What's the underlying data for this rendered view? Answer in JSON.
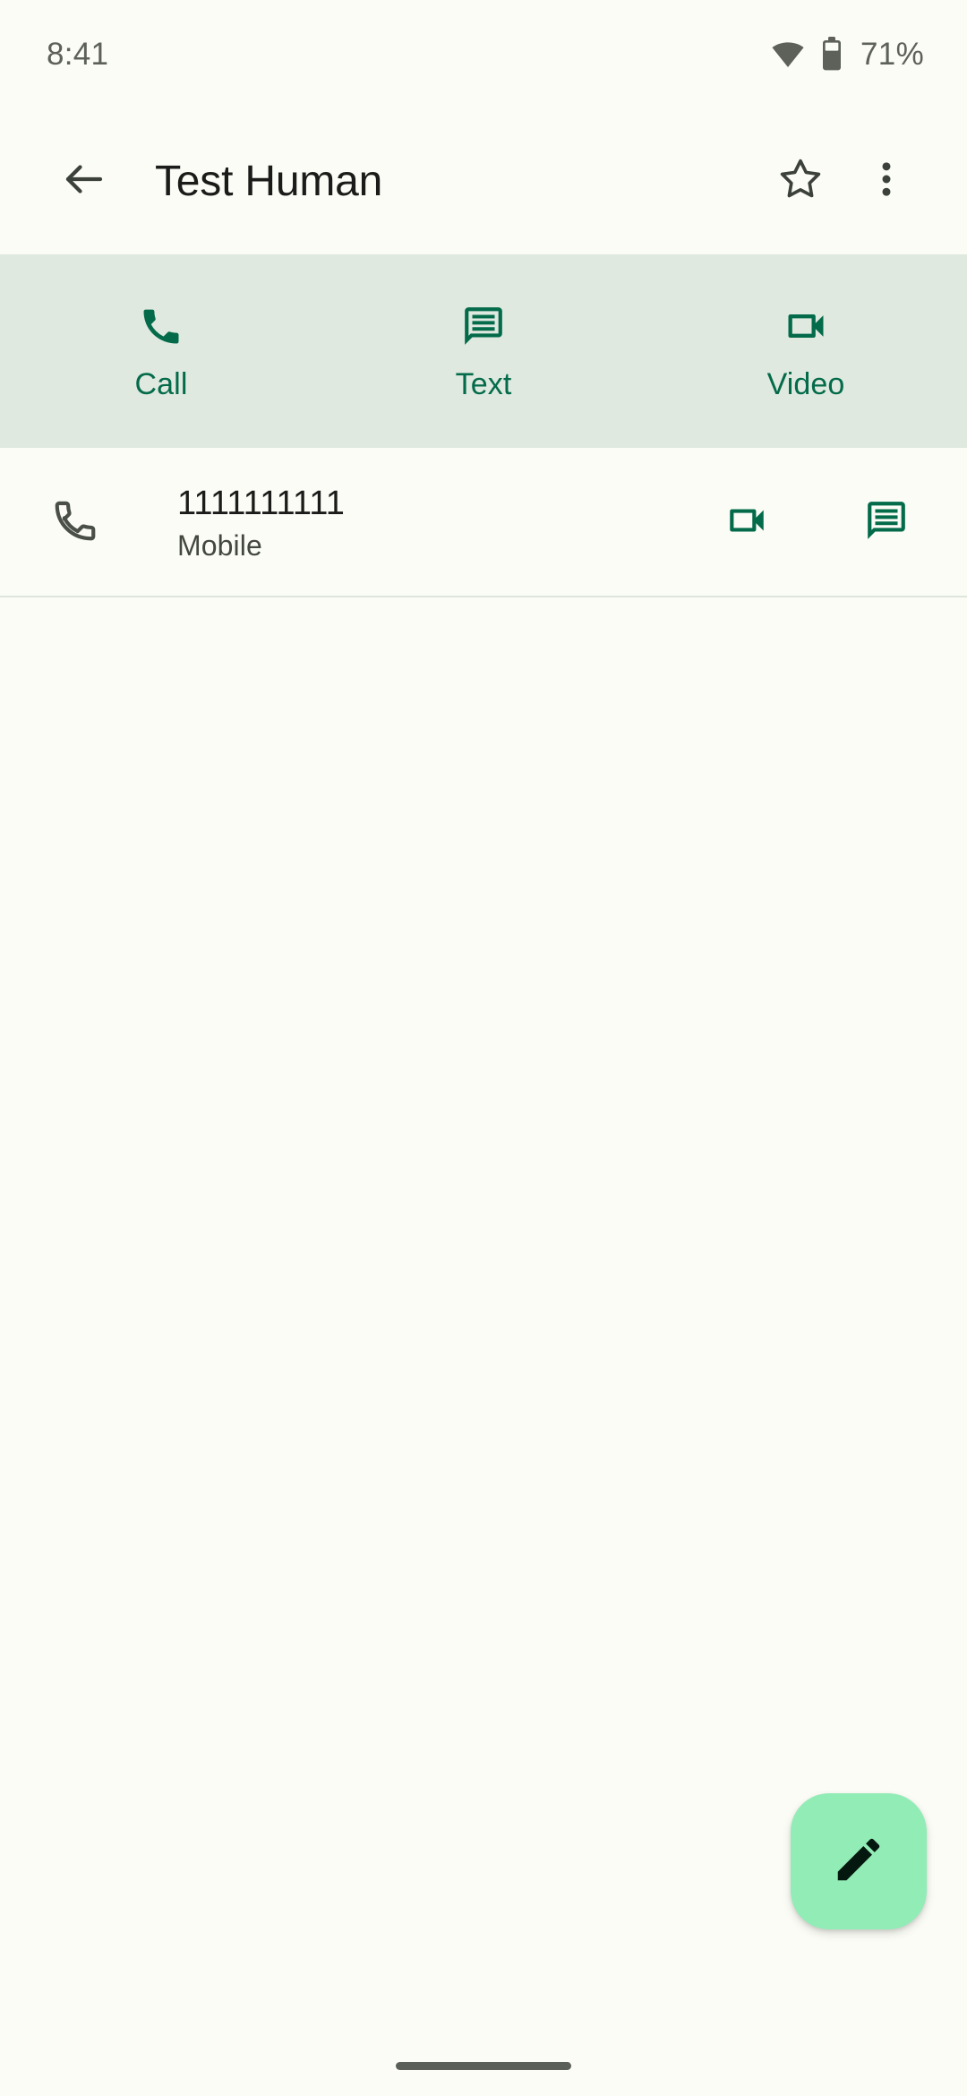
{
  "status_bar": {
    "time": "8:41",
    "battery_percent": "71%",
    "wifi_icon": "wifi-icon",
    "battery_icon": "battery-icon"
  },
  "app_bar": {
    "back_icon": "back-arrow-icon",
    "title": "Test Human",
    "favorite_icon": "star-outline-icon",
    "overflow_icon": "more-vert-icon"
  },
  "quick_actions": [
    {
      "label": "Call",
      "icon": "phone-icon"
    },
    {
      "label": "Text",
      "icon": "message-icon"
    },
    {
      "label": "Video",
      "icon": "videocam-icon"
    }
  ],
  "phone_entry": {
    "lead_icon": "phone-icon",
    "number": "1111111111",
    "type": "Mobile",
    "actions": [
      {
        "icon": "videocam-icon"
      },
      {
        "icon": "message-icon"
      }
    ]
  },
  "fab": {
    "icon": "pencil-edit-icon"
  },
  "colors": {
    "page_background": "#fbfcf6",
    "quick_action_background": "#dfe9e0",
    "accent_green": "#046b4a",
    "fab_background": "#92ecb6",
    "primary_text": "#1b1c19",
    "secondary_text": "#43483f",
    "status_text": "#5d6159",
    "divider": "#dde5dd"
  }
}
